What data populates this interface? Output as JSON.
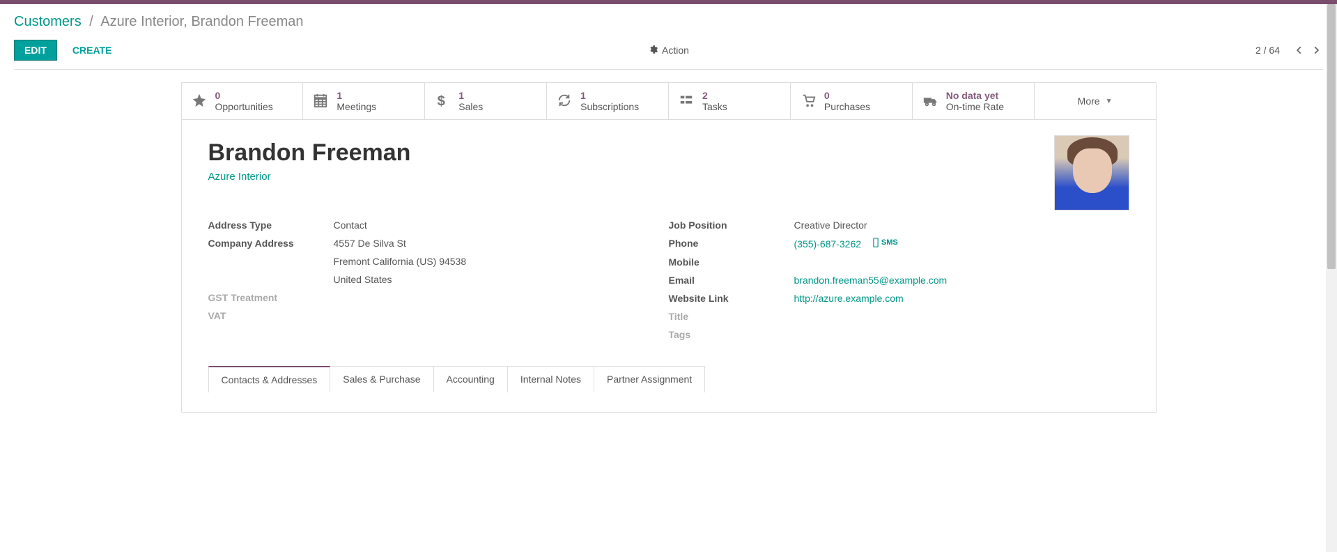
{
  "breadcrumb": {
    "root": "Customers",
    "sep": "/",
    "current": "Azure Interior, Brandon Freeman"
  },
  "toolbar": {
    "edit": "EDIT",
    "create": "CREATE",
    "action": "Action",
    "pager": "2 / 64"
  },
  "stats": {
    "opportunities": {
      "num": "0",
      "label": "Opportunities"
    },
    "meetings": {
      "num": "1",
      "label": "Meetings"
    },
    "sales": {
      "num": "1",
      "label": "Sales"
    },
    "subscriptions": {
      "num": "1",
      "label": "Subscriptions"
    },
    "tasks": {
      "num": "2",
      "label": "Tasks"
    },
    "purchases": {
      "num": "0",
      "label": "Purchases"
    },
    "ontime": {
      "num": "No data yet",
      "label": "On-time Rate"
    },
    "more": "More"
  },
  "record": {
    "name": "Brandon Freeman",
    "company": "Azure Interior"
  },
  "left": {
    "address_type_label": "Address Type",
    "address_type": "Contact",
    "company_address_label": "Company Address",
    "street": "4557 De Silva St",
    "city_line": "Fremont  California (US)  94538",
    "country": "United States",
    "gst_label": "GST Treatment",
    "vat_label": "VAT"
  },
  "right": {
    "job_label": "Job Position",
    "job": "Creative Director",
    "phone_label": "Phone",
    "phone": "(355)-687-3262",
    "sms": "SMS",
    "mobile_label": "Mobile",
    "email_label": "Email",
    "email": "brandon.freeman55@example.com",
    "website_label": "Website Link",
    "website": "http://azure.example.com",
    "title_label": "Title",
    "tags_label": "Tags"
  },
  "tabs": {
    "contacts": "Contacts & Addresses",
    "sales": "Sales & Purchase",
    "accounting": "Accounting",
    "notes": "Internal Notes",
    "partner": "Partner Assignment"
  }
}
